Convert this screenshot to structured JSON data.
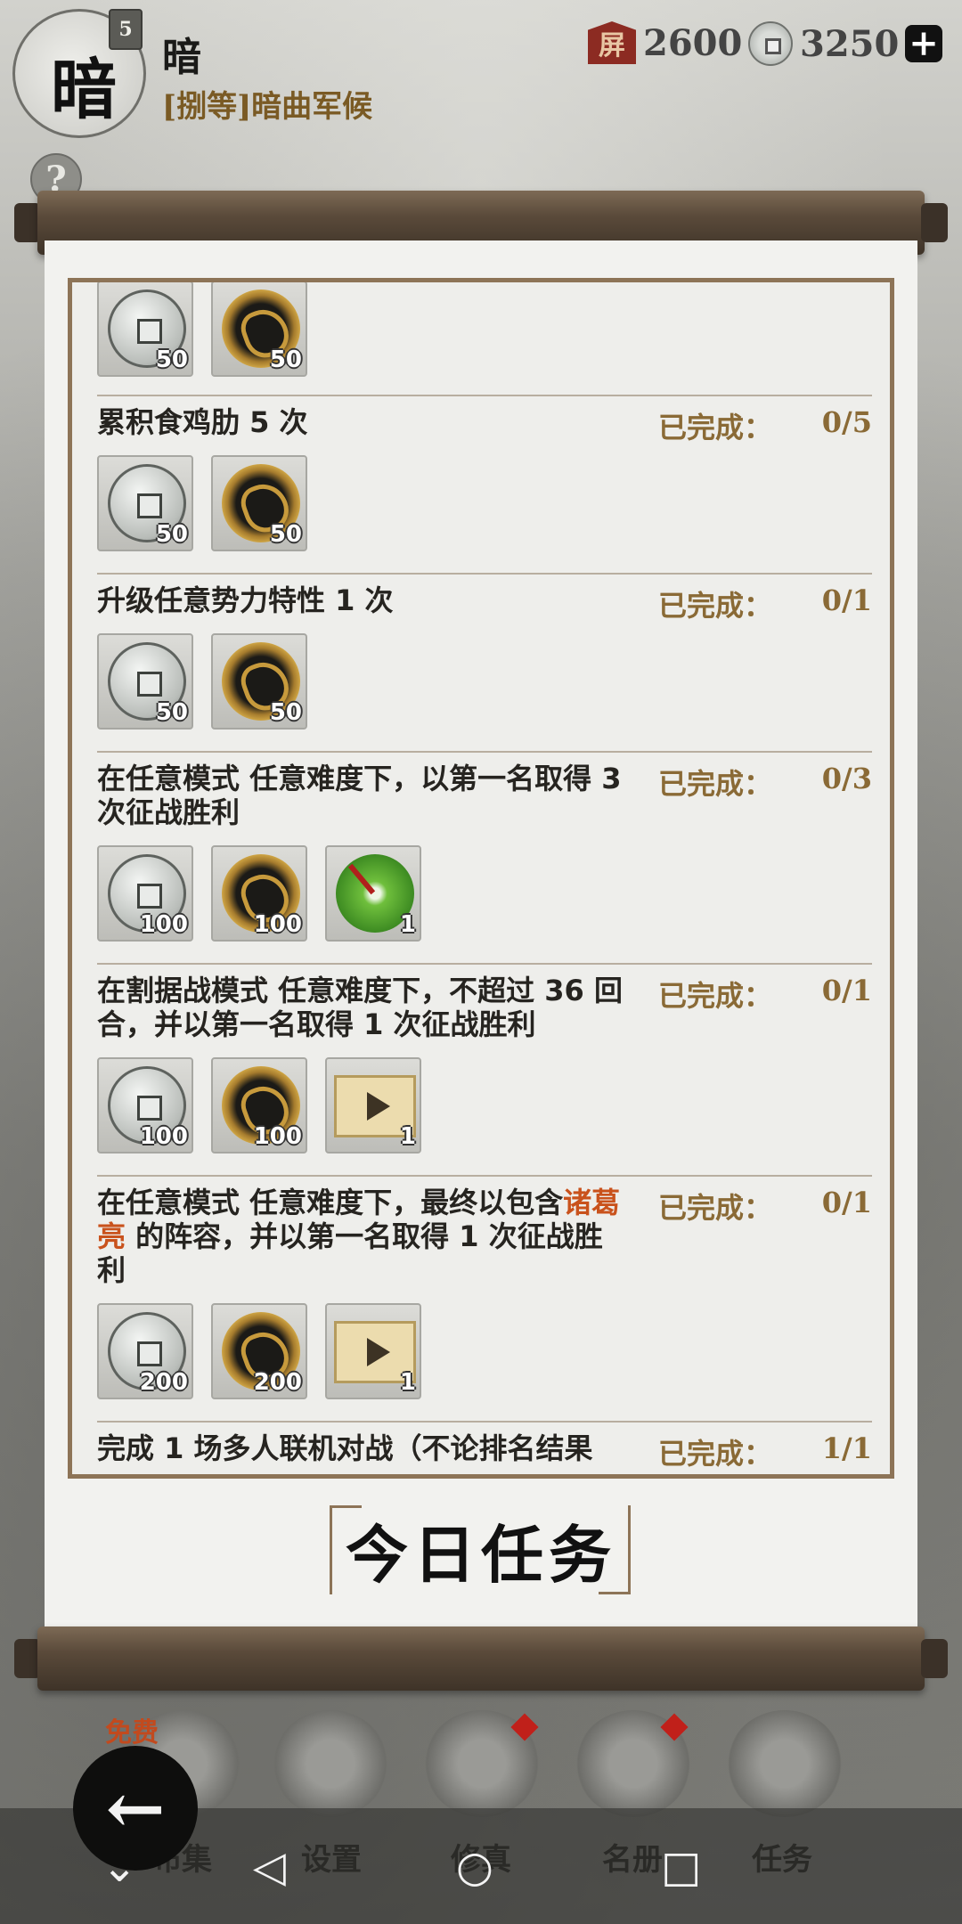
{
  "header": {
    "avatar_glyph": "暗",
    "rank": "5",
    "player_name": "暗",
    "player_title": "[捌等]暗曲军候",
    "currency_a_icon": "屏",
    "currency_a": "2600",
    "currency_b": "3250",
    "add_label": "+",
    "help_label": "?"
  },
  "tasks": [
    {
      "text": "",
      "progress_label": "",
      "progress": "",
      "rewards": [
        {
          "type": "silver-coin-icon",
          "qty": "50"
        },
        {
          "type": "gold-coin-icon",
          "qty": "50"
        }
      ]
    },
    {
      "text": "累积食鸡肋 5 次",
      "progress_label": "已完成：",
      "progress": "0/5",
      "rewards": [
        {
          "type": "silver-coin-icon",
          "qty": "50"
        },
        {
          "type": "gold-coin-icon",
          "qty": "50"
        }
      ]
    },
    {
      "text": "升级任意势力特性 1 次",
      "progress_label": "已完成：",
      "progress": "0/1",
      "rewards": [
        {
          "type": "silver-coin-icon",
          "qty": "50"
        },
        {
          "type": "gold-coin-icon",
          "qty": "50"
        }
      ]
    },
    {
      "text": "在任意模式 任意难度下，以第一名取得 3 次征战胜利",
      "progress_label": "已完成：",
      "progress": "0/3",
      "rewards": [
        {
          "type": "silver-coin-icon",
          "qty": "100"
        },
        {
          "type": "gold-coin-icon",
          "qty": "100"
        },
        {
          "type": "jade-icon",
          "qty": "1"
        }
      ]
    },
    {
      "text": "在割据战模式 任意难度下，不超过 36 回合，并以第一名取得 1 次征战胜利",
      "progress_label": "已完成：",
      "progress": "0/1",
      "rewards": [
        {
          "type": "silver-coin-icon",
          "qty": "100"
        },
        {
          "type": "gold-coin-icon",
          "qty": "100"
        },
        {
          "type": "ticket-icon",
          "qty": "1"
        }
      ]
    },
    {
      "text_prefix": "在任意模式 任意难度下，最终以包含",
      "highlight": "诸葛亮",
      "text_suffix": " 的阵容，并以第一名取得 1 次征战胜利",
      "progress_label": "已完成：",
      "progress": "0/1",
      "rewards": [
        {
          "type": "silver-coin-icon",
          "qty": "200"
        },
        {
          "type": "gold-coin-icon",
          "qty": "200"
        },
        {
          "type": "ticket-icon",
          "qty": "1"
        }
      ]
    },
    {
      "text": "完成 1 场多人联机对战（不论排名结果",
      "progress_label": "已完成：",
      "progress": "1/1"
    }
  ],
  "daily_title": "今日任务",
  "nav": {
    "free_tag": "免费",
    "items": [
      "布集",
      "设置",
      "修真",
      "名册",
      "任务"
    ]
  },
  "colors": {
    "accent": "#8a6a36",
    "highlight": "#c9521c",
    "frame": "#8d7457"
  }
}
